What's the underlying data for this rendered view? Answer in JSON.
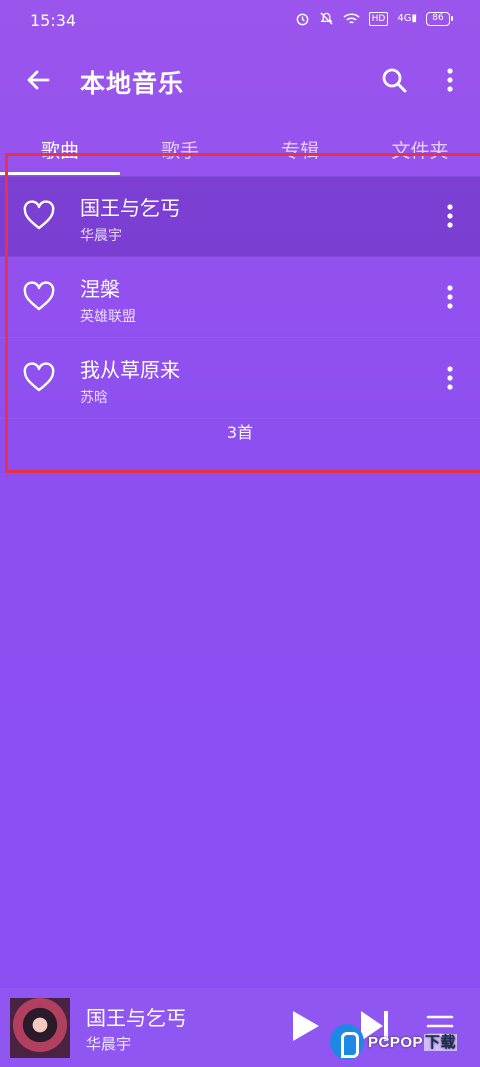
{
  "status_bar": {
    "time": "15:34",
    "icons": [
      "alarm-icon",
      "mute-icon",
      "wifi-icon",
      "hd-icon",
      "signal-4g-icon",
      "battery-icon"
    ],
    "hd_label": "HD",
    "network_label": "4G",
    "battery_level": "86"
  },
  "app_bar": {
    "title": "本地音乐"
  },
  "tabs": [
    {
      "label": "歌曲",
      "active": true
    },
    {
      "label": "歌手",
      "active": false
    },
    {
      "label": "专辑",
      "active": false
    },
    {
      "label": "文件夹",
      "active": false
    }
  ],
  "songs": [
    {
      "title": "国王与乞丐",
      "artist": "华晨宇",
      "playing": true
    },
    {
      "title": "涅槃",
      "artist": "英雄联盟",
      "playing": false
    },
    {
      "title": "我从草原来",
      "artist": "苏晗",
      "playing": false
    }
  ],
  "song_count": "3首",
  "now_playing": {
    "title": "国王与乞丐",
    "artist": "华晨宇"
  },
  "watermark": {
    "brand": "PCPOP",
    "suffix": "下载"
  },
  "colors": {
    "background": "#8e4ff0",
    "highlight_box": "#e8324a",
    "active_indicator": "#ffffff"
  }
}
